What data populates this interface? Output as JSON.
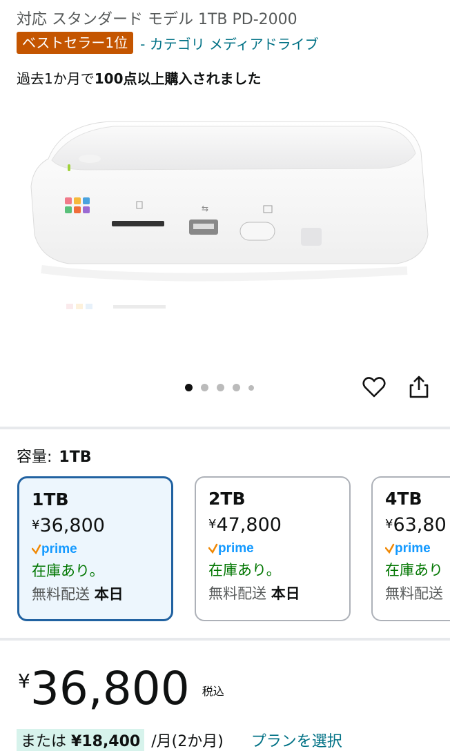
{
  "product": {
    "title_line2": "対応 スタンダード モデル 1TB PD-2000",
    "badge": "ベストセラー1位",
    "category_link": "- カテゴリ メディアドライブ",
    "purchase_note_prefix": "過去1か月で",
    "purchase_note_strong": "100点以上購入されました"
  },
  "gallery": {
    "dot_count": 5,
    "active_index": 0
  },
  "capacity": {
    "label": "容量:",
    "selected_value": "1TB",
    "options": [
      {
        "name": "1TB",
        "price": "36,800",
        "stock": "在庫あり。",
        "ship_prefix": "無料配送",
        "ship_day": "本日"
      },
      {
        "name": "2TB",
        "price": "47,800",
        "stock": "在庫あり。",
        "ship_prefix": "無料配送",
        "ship_day": "本日"
      },
      {
        "name": "4TB",
        "price": "63,80",
        "stock": "在庫あり",
        "ship_prefix": "無料配送",
        "ship_day": ""
      }
    ]
  },
  "currency_symbol": "¥",
  "prime_label": "prime",
  "price": {
    "symbol": "¥",
    "amount": "36,800",
    "tax": "税込"
  },
  "installment": {
    "prefix": "または",
    "amount": "¥18,400",
    "period": "/月(2か月)",
    "plan_link": "プランを選択"
  },
  "colors": {
    "accent": "#2162a1",
    "badge": "#c45500",
    "link": "#007185",
    "in_stock": "#007600",
    "prime": "#1399ff"
  },
  "icons": {
    "wishlist": "heart-icon",
    "share": "share-icon"
  }
}
